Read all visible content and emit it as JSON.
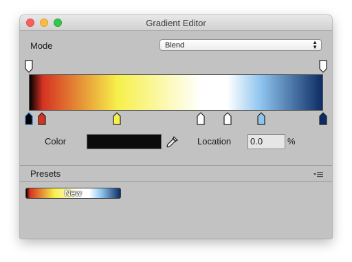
{
  "window": {
    "title": "Gradient Editor"
  },
  "mode": {
    "label": "Mode",
    "value": "Blend"
  },
  "gradient": {
    "color_stops": [
      {
        "pos": 0.0,
        "color": "#000000",
        "selected": true
      },
      {
        "pos": 0.045,
        "color": "#d63222"
      },
      {
        "pos": 0.3,
        "color": "#f6f04a"
      },
      {
        "pos": 0.585,
        "color": "#ffffff"
      },
      {
        "pos": 0.675,
        "color": "#ffffff"
      },
      {
        "pos": 0.79,
        "color": "#8ec4ee"
      },
      {
        "pos": 1.0,
        "color": "#0d2c64"
      }
    ],
    "alpha_stops": [
      {
        "pos": 0.0
      },
      {
        "pos": 1.0
      }
    ]
  },
  "selection": {
    "color_label": "Color",
    "color_value": "#0b0b0b",
    "location_label": "Location",
    "location_value": "0.0",
    "location_unit": "%"
  },
  "presets": {
    "label": "Presets",
    "items": [
      {
        "label": "New"
      }
    ]
  }
}
